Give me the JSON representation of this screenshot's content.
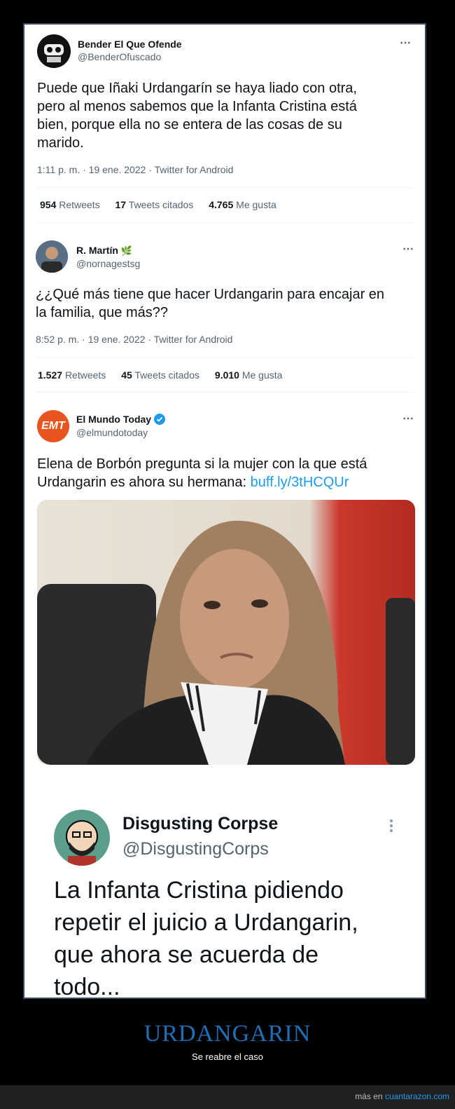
{
  "tweets": [
    {
      "name": "Bender El Que Ofende",
      "handle": "@BenderOfuscado",
      "text": [
        "Puede que Iñaki Urdangarín se haya liado con otra,",
        "pero al menos sabemos que la Infanta Cristina está",
        "bien, porque ella no se entera de las cosas de su",
        "marido."
      ],
      "meta": "1:11 p. m. · 19 ene. 2022 · Twitter for Android",
      "retweets": "954",
      "retweets_label": "Retweets",
      "quotes": "17",
      "quotes_label": "Tweets citados",
      "likes": "4.765",
      "likes_label": "Me gusta"
    },
    {
      "name": "R. Martín",
      "name_emoji": "🌿",
      "handle": "@nornagestsg",
      "text": [
        "¿¿Qué más tiene que hacer Urdangarin para encajar en",
        "la familia, que más??"
      ],
      "meta": "8:52 p. m. · 19 ene. 2022 · Twitter for Android",
      "retweets": "1.527",
      "retweets_label": "Retweets",
      "quotes": "45",
      "quotes_label": "Tweets citados",
      "likes": "9.010",
      "likes_label": "Me gusta"
    },
    {
      "name": "El Mundo Today",
      "handle": "@elmundotoday",
      "avatar_text": "EMT",
      "text": [
        "Elena de Borbón pregunta si la mujer con la que está"
      ],
      "text_line2_prefix": "Urdangarin es ahora su hermana: ",
      "link": "buff.ly/3tHCQUr"
    },
    {
      "name": "Disgusting Corpse",
      "handle": "@DisgustingCorps",
      "text": [
        "La Infanta Cristina pidiendo",
        "repetir el juicio a Urdangarin,",
        "que ahora se acuerda de",
        "todo..."
      ]
    }
  ],
  "more_icon": "⋯",
  "footer": {
    "title": "URDANGARIN",
    "subtitle": "Se reabre el caso",
    "credit_prefix": "más en ",
    "credit_link": "cuantarazon.com"
  },
  "colors": {
    "link": "#1d9bf0",
    "footer_title": "#1e6fb8",
    "verified": "#1d9bf0"
  }
}
